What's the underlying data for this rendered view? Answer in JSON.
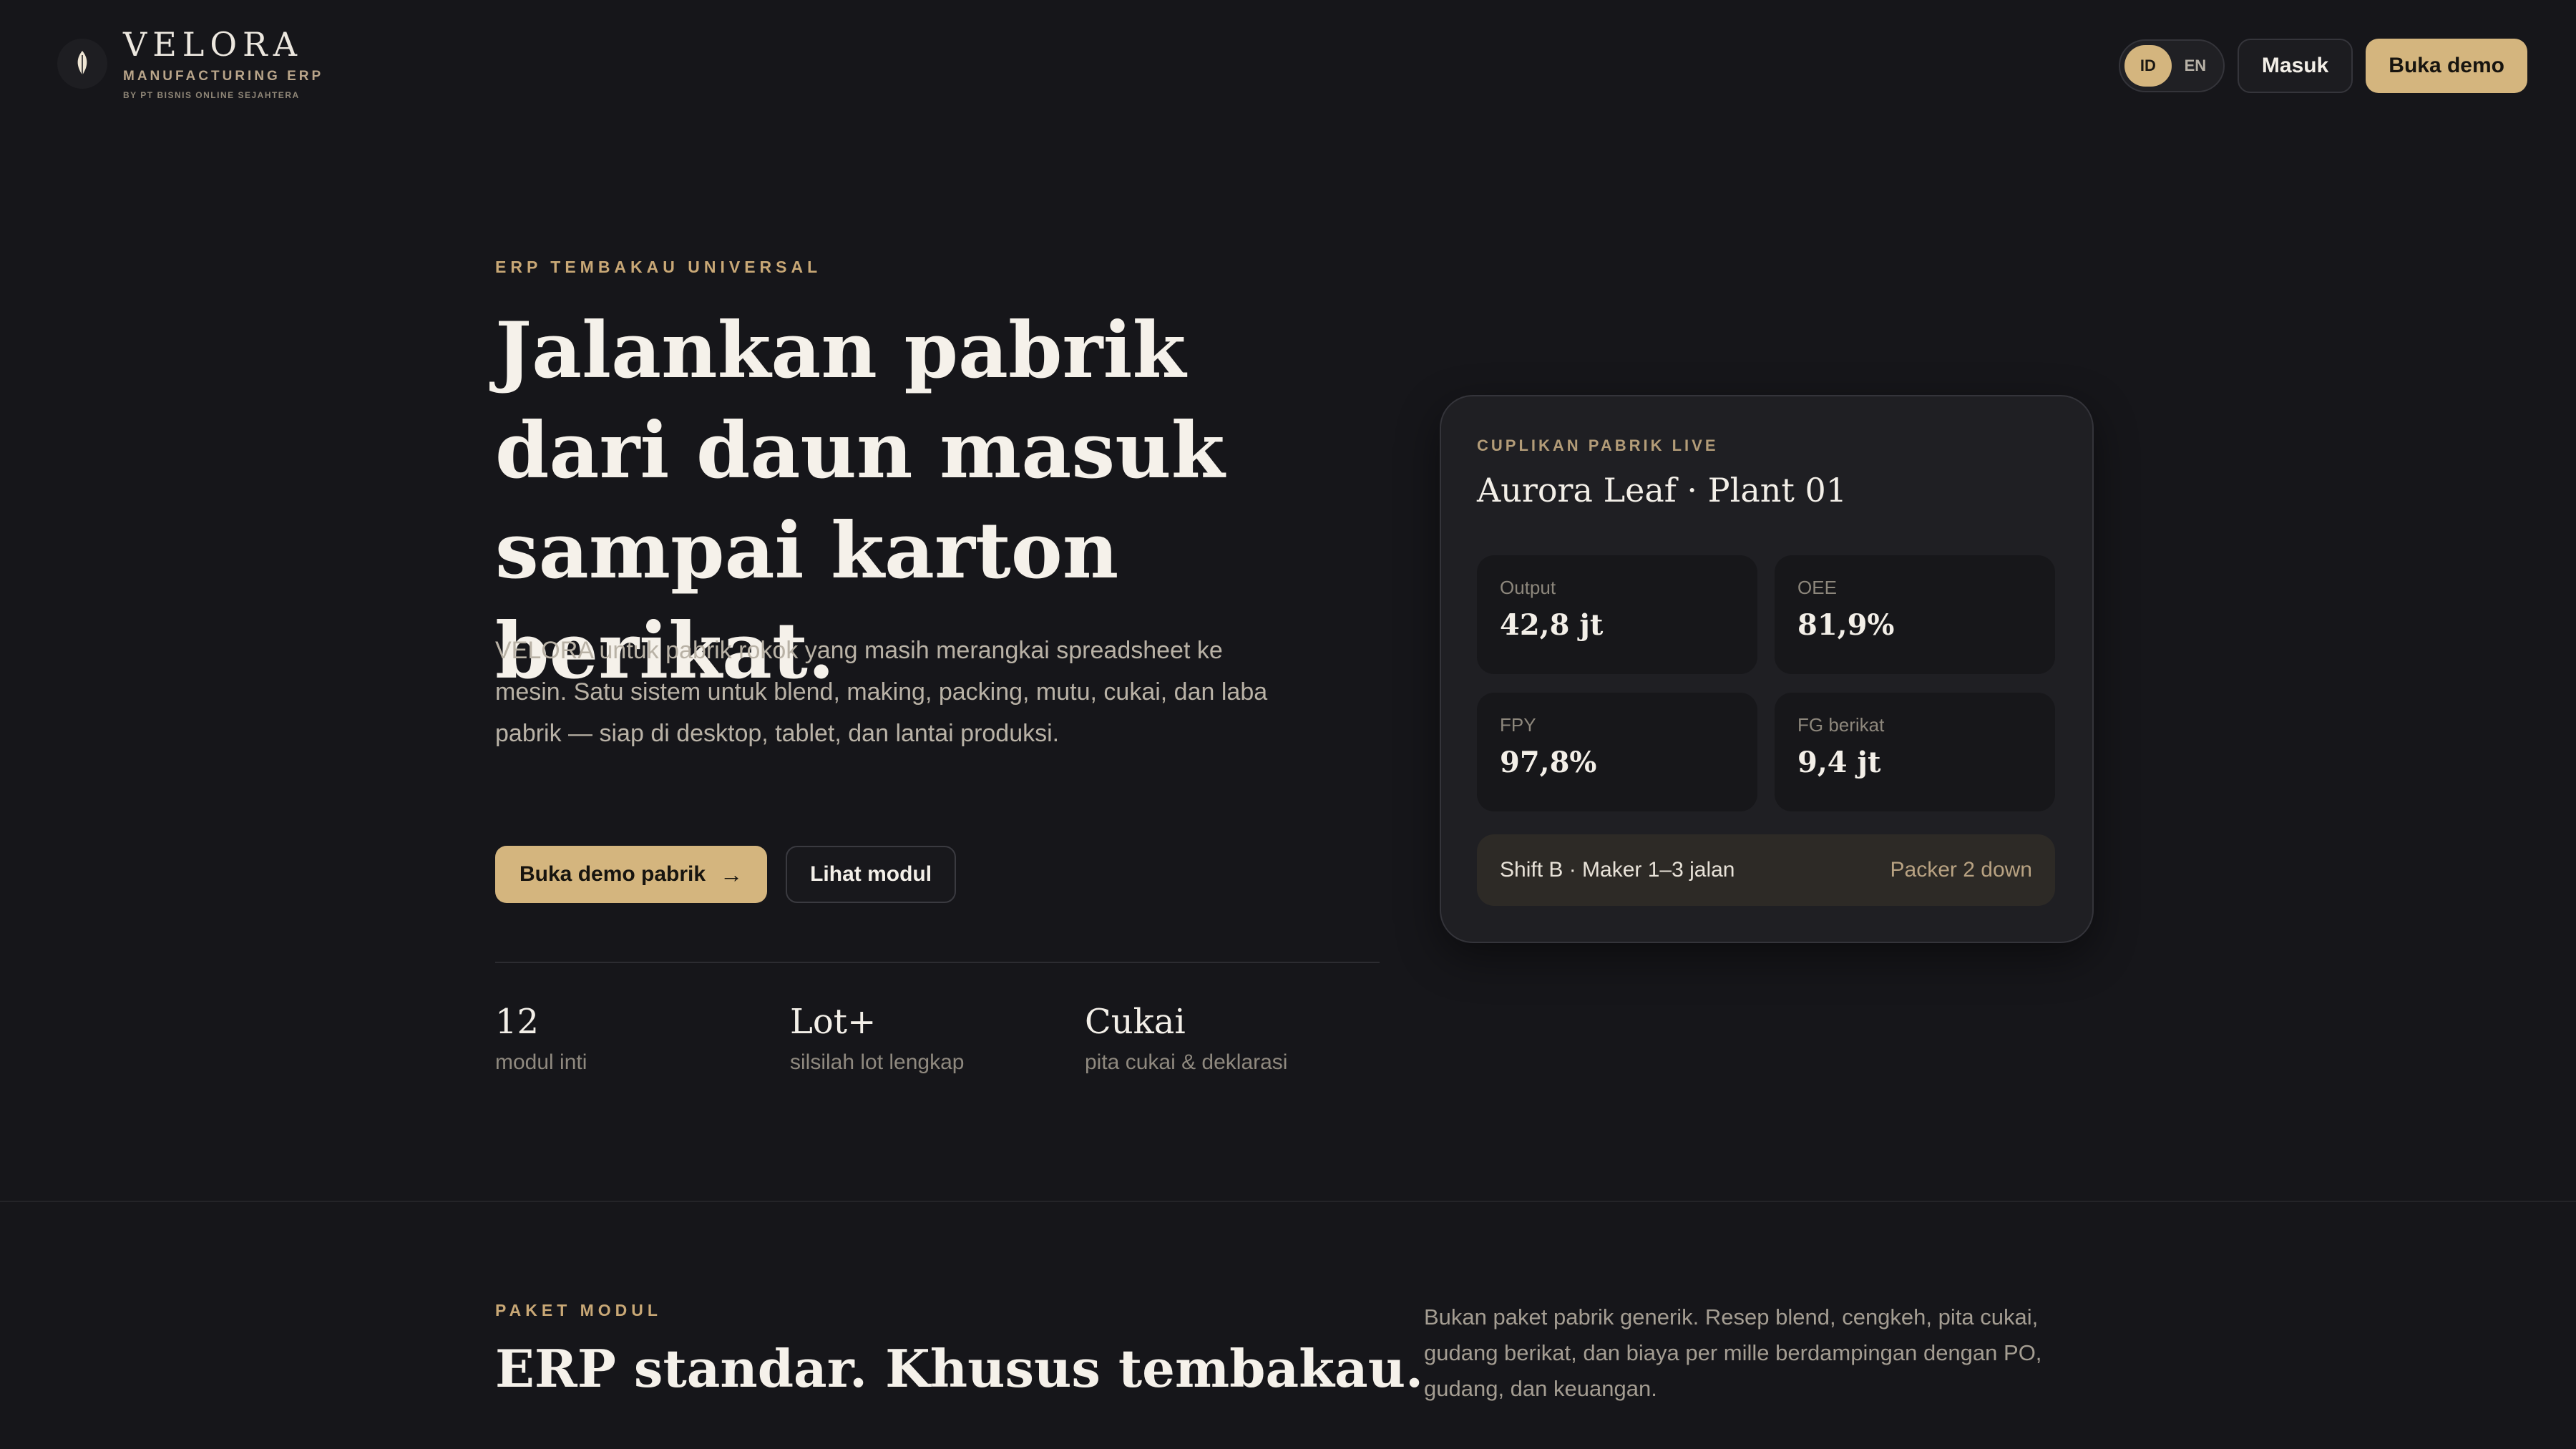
{
  "brand": {
    "name": "VELORA",
    "subtitle": "MANUFACTURING ERP",
    "by": "BY PT BISNIS ONLINE SEJAHTERA",
    "logo_icon": "leaf-icon"
  },
  "header": {
    "lang_options": [
      "ID",
      "EN"
    ],
    "lang_selected": "ID",
    "login_label": "Masuk",
    "demo_label": "Buka demo"
  },
  "hero": {
    "eyebrow": "ERP TEMBAKAU UNIVERSAL",
    "title": "Jalankan pabrik dari daun masuk sampai karton berikat.",
    "description": "VELORA untuk pabrik rokok yang masih merangkai spreadsheet ke mesin. Satu sistem untuk blend, making, packing, mutu, cukai, dan laba pabrik — siap di desktop, tablet, dan lantai produksi.",
    "primary_cta": "Buka demo pabrik",
    "secondary_cta": "Lihat modul",
    "stats": [
      {
        "value": "12",
        "label": "modul inti"
      },
      {
        "value": "Lot+",
        "label": "silsilah lot lengkap"
      },
      {
        "value": "Cukai",
        "label": "pita cukai & deklarasi"
      }
    ]
  },
  "live_card": {
    "eyebrow": "CUPLIKAN PABRIK LIVE",
    "title": "Aurora Leaf · Plant 01",
    "kpis": [
      {
        "label": "Output",
        "value": "42,8 jt"
      },
      {
        "label": "OEE",
        "value": "81,9%"
      },
      {
        "label": "FPY",
        "value": "97,8%"
      },
      {
        "label": "FG berikat",
        "value": "9,4 jt"
      }
    ],
    "shift_status": "Shift B · Maker 1–3 jalan",
    "alert": "Packer 2 down"
  },
  "modules": {
    "eyebrow": "PAKET MODUL",
    "title": "ERP standar. Khusus tembakau.",
    "description": "Bukan paket pabrik generik. Resep blend, cengkeh, pita cukai, gudang berikat, dan biaya per mille berdampingan dengan PO, gudang, dan keuangan."
  },
  "colors": {
    "background": "#16161a",
    "accent_gold": "#d4b57e",
    "card": "#1f1f23"
  }
}
